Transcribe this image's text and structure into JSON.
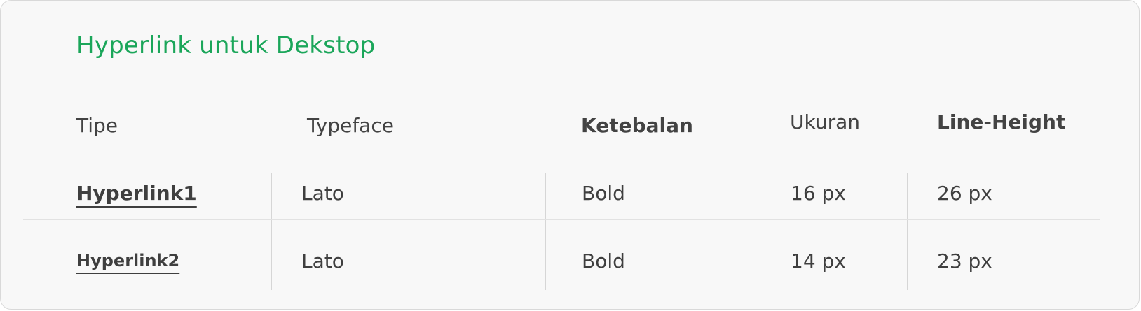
{
  "title": "Hyperlink untuk Dekstop",
  "colors": {
    "title": "#1ba65a",
    "text": "#3f3f3f",
    "card_background": "#f8f8f8",
    "border": "#d9d9d9",
    "divider": "#e2e2e2"
  },
  "table": {
    "headers": {
      "tipe": "Tipe",
      "typeface": "Typeface",
      "ketebalan": "Ketebalan",
      "ukuran": "Ukuran",
      "line_height": "Line-Height"
    },
    "rows": [
      {
        "tipe": "Hyperlink1",
        "typeface": "Lato",
        "ketebalan": "Bold",
        "ukuran": "16 px",
        "line_height": "26 px"
      },
      {
        "tipe": "Hyperlink2",
        "typeface": "Lato",
        "ketebalan": "Bold",
        "ukuran": "14 px",
        "line_height": "23 px"
      }
    ]
  }
}
